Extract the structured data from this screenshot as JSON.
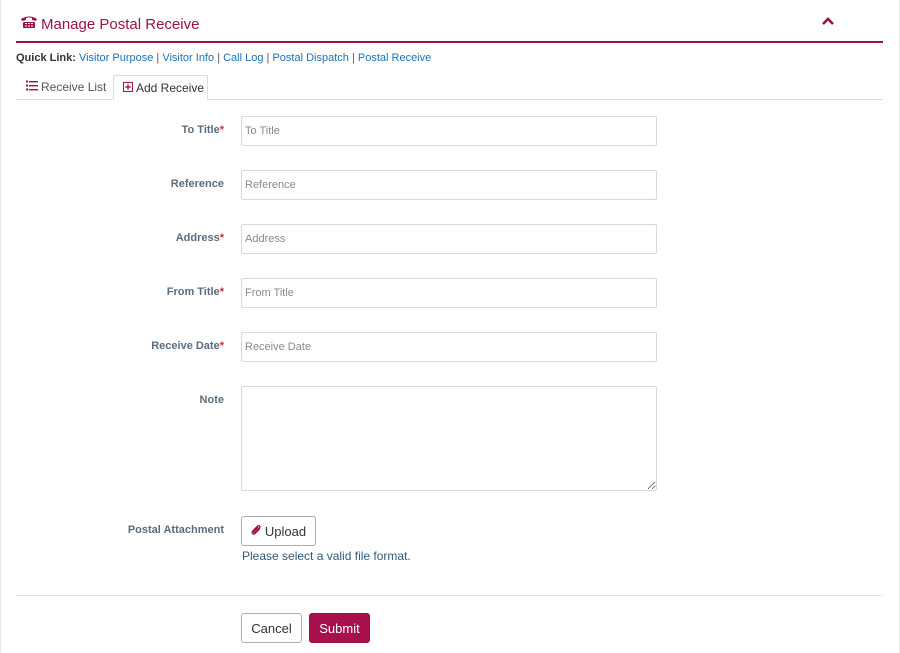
{
  "header": {
    "title": "Manage Postal Receive",
    "icon": "phone-icon",
    "accent": "#9e1048"
  },
  "quicklinks": {
    "label": "Quick Link:",
    "links": [
      "Visitor Purpose",
      "Visitor Info",
      "Call Log",
      "Postal Dispatch",
      "Postal Receive"
    ]
  },
  "tabs": [
    {
      "label": "Receive List",
      "icon": "list-icon",
      "active": false
    },
    {
      "label": "Add Receive",
      "icon": "plus-square-icon",
      "active": true
    }
  ],
  "form": {
    "to_title": {
      "label": "To Title",
      "required": "*",
      "placeholder": "To Title"
    },
    "reference": {
      "label": "Reference",
      "placeholder": "Reference"
    },
    "address": {
      "label": "Address",
      "required": "*",
      "placeholder": "Address"
    },
    "from_title": {
      "label": "From Title",
      "required": "*",
      "placeholder": "From Title"
    },
    "receive_date": {
      "label": "Receive Date",
      "required": "*",
      "placeholder": "Receive Date"
    },
    "note": {
      "label": "Note"
    },
    "attachment": {
      "label": "Postal Attachment",
      "upload_label": "Upload",
      "help": "Please select a valid file format."
    }
  },
  "actions": {
    "cancel": "Cancel",
    "submit": "Submit"
  }
}
